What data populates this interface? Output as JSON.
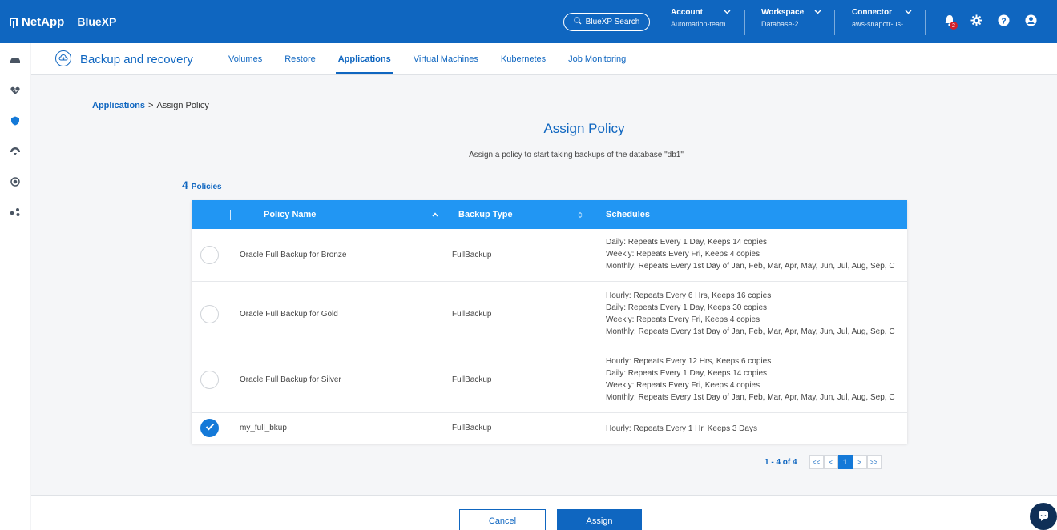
{
  "brand": {
    "company": "NetApp",
    "product": "BlueXP"
  },
  "topbar": {
    "search_label": "BlueXP Search",
    "account": {
      "title": "Account",
      "value": "Automation-team"
    },
    "workspace": {
      "title": "Workspace",
      "value": "Database-2"
    },
    "connector": {
      "title": "Connector",
      "value": "aws-snapctr-us-..."
    },
    "notification_count": "2",
    "icons": [
      "bell-icon",
      "gear-icon",
      "help-icon",
      "user-icon"
    ]
  },
  "rail": {
    "icons": [
      "storage-icon",
      "health-icon",
      "protection-icon",
      "mobility-icon",
      "governance-icon",
      "extensions-icon"
    ]
  },
  "service": {
    "title": "Backup and recovery",
    "tabs": [
      {
        "label": "Volumes"
      },
      {
        "label": "Restore"
      },
      {
        "label": "Applications",
        "active": true
      },
      {
        "label": "Virtual Machines"
      },
      {
        "label": "Kubernetes"
      },
      {
        "label": "Job Monitoring"
      }
    ]
  },
  "breadcrumb": {
    "parent": "Applications",
    "separator": ">",
    "current": "Assign Policy"
  },
  "page": {
    "title": "Assign Policy",
    "subtitle": "Assign a policy to start taking backups of the database \"db1\""
  },
  "policies": {
    "count": "4",
    "count_label": "Policies",
    "columns": {
      "name": "Policy Name",
      "type": "Backup Type",
      "schedules": "Schedules"
    },
    "rows": [
      {
        "name": "Oracle Full Backup for Bronze",
        "type": "FullBackup",
        "selected": false,
        "schedules": [
          "Daily: Repeats Every 1 Day, Keeps 14 copies",
          "Weekly: Repeats Every Fri, Keeps 4 copies",
          "Monthly: Repeats Every 1st Day of Jan, Feb, Mar, Apr, May, Jun, Jul, Aug, Sep, C"
        ]
      },
      {
        "name": "Oracle Full Backup for Gold",
        "type": "FullBackup",
        "selected": false,
        "schedules": [
          "Hourly: Repeats Every 6 Hrs, Keeps 16 copies",
          "Daily: Repeats Every 1 Day, Keeps 30 copies",
          "Weekly: Repeats Every Fri, Keeps 4 copies",
          "Monthly: Repeats Every 1st Day of Jan, Feb, Mar, Apr, May, Jun, Jul, Aug, Sep, C"
        ]
      },
      {
        "name": "Oracle Full Backup for Silver",
        "type": "FullBackup",
        "selected": false,
        "schedules": [
          "Hourly: Repeats Every 12 Hrs, Keeps 6 copies",
          "Daily: Repeats Every 1 Day, Keeps 14 copies",
          "Weekly: Repeats Every Fri, Keeps 4 copies",
          "Monthly: Repeats Every 1st Day of Jan, Feb, Mar, Apr, May, Jun, Jul, Aug, Sep, C"
        ]
      },
      {
        "name": "my_full_bkup",
        "type": "FullBackup",
        "selected": true,
        "schedules": [
          "Hourly: Repeats Every 1 Hr, Keeps 3 Days"
        ]
      }
    ]
  },
  "pagination": {
    "range": "1 - 4 of 4",
    "first": "<<",
    "prev": "<",
    "current": "1",
    "next": ">",
    "last": ">>"
  },
  "footer": {
    "cancel": "Cancel",
    "assign": "Assign"
  },
  "colors": {
    "primary": "#0f66c0",
    "table_header": "#2196f3",
    "badge": "#d0212b"
  }
}
